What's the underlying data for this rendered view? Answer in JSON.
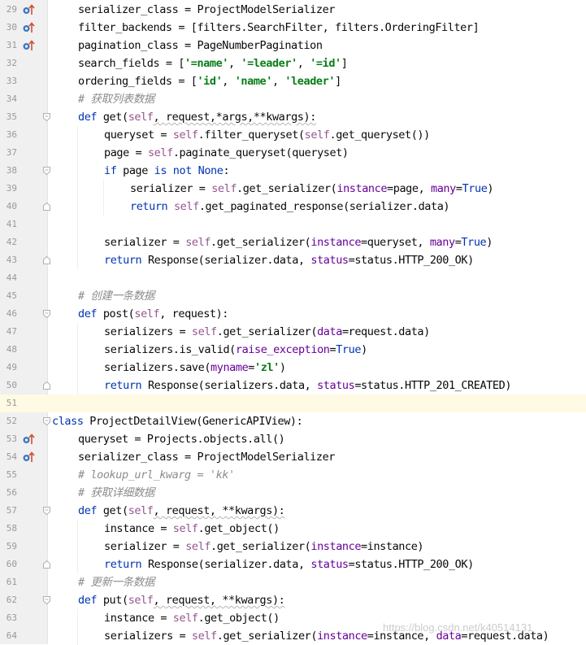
{
  "editor": {
    "language": "python",
    "current_line": 51,
    "watermark": "https://blog.csdn.net/k40514131"
  },
  "colors": {
    "keyword": "#0033b3",
    "self": "#94558d",
    "string": "#067d17",
    "comment": "#8c8c8c",
    "param": "#660099",
    "plain": "#080808",
    "gutter_bg": "#f0f0f0",
    "current_line_bg": "#fffae3",
    "override_marker": "#3d77c7",
    "override_arrow": "#d14f2d"
  },
  "lines": [
    {
      "n": "29",
      "indent": 1,
      "marker": "override",
      "fold": "",
      "tokens": [
        [
          "serializer_class = ProjectModelSerializer",
          "p"
        ]
      ]
    },
    {
      "n": "30",
      "indent": 1,
      "marker": "override",
      "fold": "",
      "tokens": [
        [
          "filter_backends = [filters.SearchFilter, filters.OrderingFilter]",
          "p"
        ]
      ]
    },
    {
      "n": "31",
      "indent": 1,
      "marker": "override",
      "fold": "",
      "tokens": [
        [
          "pagination_class = PageNumberPagination",
          "p"
        ]
      ]
    },
    {
      "n": "32",
      "indent": 1,
      "marker": "",
      "fold": "",
      "tokens": [
        [
          "search_fields = [",
          "p"
        ],
        [
          "'=name'",
          "s"
        ],
        [
          ", ",
          "p"
        ],
        [
          "'=leader'",
          "s"
        ],
        [
          ", ",
          "p"
        ],
        [
          "'=id'",
          "s"
        ],
        [
          "]",
          "p"
        ]
      ]
    },
    {
      "n": "33",
      "indent": 1,
      "marker": "",
      "fold": "",
      "tokens": [
        [
          "ordering_fields = [",
          "p"
        ],
        [
          "'id'",
          "s"
        ],
        [
          ", ",
          "p"
        ],
        [
          "'name'",
          "s"
        ],
        [
          ", ",
          "p"
        ],
        [
          "'leader'",
          "s"
        ],
        [
          "]",
          "p"
        ]
      ]
    },
    {
      "n": "34",
      "indent": 1,
      "marker": "",
      "fold": "",
      "tokens": [
        [
          "# 获取列表数据",
          "c"
        ]
      ]
    },
    {
      "n": "35",
      "indent": 1,
      "marker": "",
      "fold": "open",
      "tokens": [
        [
          "def ",
          "k"
        ],
        [
          "get(",
          "p"
        ],
        [
          "self",
          "f"
        ],
        [
          ", request,*args,**kwargs):",
          "pw"
        ]
      ]
    },
    {
      "n": "36",
      "indent": 2,
      "marker": "",
      "fold": "",
      "tokens": [
        [
          "queryset = ",
          "p"
        ],
        [
          "self",
          "f"
        ],
        [
          ".filter_queryset(",
          "p"
        ],
        [
          "self",
          "f"
        ],
        [
          ".get_queryset())",
          "p"
        ]
      ]
    },
    {
      "n": "37",
      "indent": 2,
      "marker": "",
      "fold": "",
      "tokens": [
        [
          "page = ",
          "p"
        ],
        [
          "self",
          "f"
        ],
        [
          ".paginate_queryset(queryset)",
          "p"
        ]
      ]
    },
    {
      "n": "38",
      "indent": 2,
      "marker": "",
      "fold": "open",
      "tokens": [
        [
          "if ",
          "k"
        ],
        [
          "page ",
          "p"
        ],
        [
          "is not None",
          "k"
        ],
        [
          ":",
          "p"
        ]
      ]
    },
    {
      "n": "39",
      "indent": 3,
      "marker": "",
      "fold": "",
      "tokens": [
        [
          "serializer = ",
          "p"
        ],
        [
          "self",
          "f"
        ],
        [
          ".get_serializer(",
          "p"
        ],
        [
          "instance",
          "a"
        ],
        [
          "=page, ",
          "p"
        ],
        [
          "many",
          "a"
        ],
        [
          "=",
          "p"
        ],
        [
          "True",
          "k"
        ],
        [
          ")",
          "p"
        ]
      ]
    },
    {
      "n": "40",
      "indent": 3,
      "marker": "",
      "fold": "close",
      "tokens": [
        [
          "return ",
          "k"
        ],
        [
          "self",
          "f"
        ],
        [
          ".get_paginated_response(serializer.data)",
          "p"
        ]
      ]
    },
    {
      "n": "41",
      "indent": 2,
      "marker": "",
      "fold": "",
      "tokens": []
    },
    {
      "n": "42",
      "indent": 2,
      "marker": "",
      "fold": "",
      "tokens": [
        [
          "serializer = ",
          "p"
        ],
        [
          "self",
          "f"
        ],
        [
          ".get_serializer(",
          "p"
        ],
        [
          "instance",
          "a"
        ],
        [
          "=queryset, ",
          "p"
        ],
        [
          "many",
          "a"
        ],
        [
          "=",
          "p"
        ],
        [
          "True",
          "k"
        ],
        [
          ")",
          "p"
        ]
      ]
    },
    {
      "n": "43",
      "indent": 2,
      "marker": "",
      "fold": "close",
      "tokens": [
        [
          "return ",
          "k"
        ],
        [
          "Response(serializer.data, ",
          "p"
        ],
        [
          "status",
          "a"
        ],
        [
          "=status.HTTP_200_OK)",
          "p"
        ]
      ]
    },
    {
      "n": "44",
      "indent": 1,
      "marker": "",
      "fold": "",
      "tokens": []
    },
    {
      "n": "45",
      "indent": 1,
      "marker": "",
      "fold": "",
      "tokens": [
        [
          "# 创建一条数据",
          "c"
        ]
      ]
    },
    {
      "n": "46",
      "indent": 1,
      "marker": "",
      "fold": "open",
      "tokens": [
        [
          "def ",
          "k"
        ],
        [
          "post(",
          "p"
        ],
        [
          "self",
          "f"
        ],
        [
          ", request):",
          "p"
        ]
      ]
    },
    {
      "n": "47",
      "indent": 2,
      "marker": "",
      "fold": "",
      "tokens": [
        [
          "serializers = ",
          "p"
        ],
        [
          "self",
          "f"
        ],
        [
          ".get_serializer(",
          "p"
        ],
        [
          "data",
          "a"
        ],
        [
          "=request.data)",
          "p"
        ]
      ]
    },
    {
      "n": "48",
      "indent": 2,
      "marker": "",
      "fold": "",
      "tokens": [
        [
          "serializers.is_valid(",
          "p"
        ],
        [
          "raise_exception",
          "a"
        ],
        [
          "=",
          "p"
        ],
        [
          "True",
          "k"
        ],
        [
          ")",
          "p"
        ]
      ]
    },
    {
      "n": "49",
      "indent": 2,
      "marker": "",
      "fold": "",
      "tokens": [
        [
          "serializers.save(",
          "p"
        ],
        [
          "myname",
          "a"
        ],
        [
          "=",
          "p"
        ],
        [
          "'zl'",
          "s"
        ],
        [
          ")",
          "p"
        ]
      ]
    },
    {
      "n": "50",
      "indent": 2,
      "marker": "",
      "fold": "close",
      "tokens": [
        [
          "return ",
          "k"
        ],
        [
          "Response(serializers.data, ",
          "p"
        ],
        [
          "status",
          "a"
        ],
        [
          "=status.HTTP_201_CREATED)",
          "p"
        ]
      ]
    },
    {
      "n": "51",
      "indent": 0,
      "marker": "",
      "fold": "",
      "tokens": []
    },
    {
      "n": "52",
      "indent": 0,
      "marker": "",
      "fold": "open",
      "tokens": [
        [
          "class ",
          "k"
        ],
        [
          "ProjectDetailView(GenericAPIView):",
          "p"
        ]
      ]
    },
    {
      "n": "53",
      "indent": 1,
      "marker": "override",
      "fold": "",
      "tokens": [
        [
          "queryset = Projects.objects.all()",
          "p"
        ]
      ]
    },
    {
      "n": "54",
      "indent": 1,
      "marker": "override",
      "fold": "",
      "tokens": [
        [
          "serializer_class = ProjectModelSerializer",
          "p"
        ]
      ]
    },
    {
      "n": "55",
      "indent": 1,
      "marker": "",
      "fold": "",
      "tokens": [
        [
          "# lookup_url_kwarg = 'kk'",
          "c"
        ]
      ]
    },
    {
      "n": "56",
      "indent": 1,
      "marker": "",
      "fold": "",
      "tokens": [
        [
          "# 获取详细数据",
          "c"
        ]
      ]
    },
    {
      "n": "57",
      "indent": 1,
      "marker": "",
      "fold": "open",
      "tokens": [
        [
          "def ",
          "k"
        ],
        [
          "get(",
          "p"
        ],
        [
          "self",
          "f"
        ],
        [
          ", request, **kwargs):",
          "pw"
        ]
      ]
    },
    {
      "n": "58",
      "indent": 2,
      "marker": "",
      "fold": "",
      "tokens": [
        [
          "instance = ",
          "p"
        ],
        [
          "self",
          "f"
        ],
        [
          ".get_object()",
          "p"
        ]
      ]
    },
    {
      "n": "59",
      "indent": 2,
      "marker": "",
      "fold": "",
      "tokens": [
        [
          "serializer = ",
          "p"
        ],
        [
          "self",
          "f"
        ],
        [
          ".get_serializer(",
          "p"
        ],
        [
          "instance",
          "a"
        ],
        [
          "=instance)",
          "p"
        ]
      ]
    },
    {
      "n": "60",
      "indent": 2,
      "marker": "",
      "fold": "close",
      "tokens": [
        [
          "return ",
          "k"
        ],
        [
          "Response(serializer.data, ",
          "p"
        ],
        [
          "status",
          "a"
        ],
        [
          "=status.HTTP_200_OK)",
          "p"
        ]
      ]
    },
    {
      "n": "61",
      "indent": 1,
      "marker": "",
      "fold": "",
      "tokens": [
        [
          "# 更新一条数据",
          "c"
        ]
      ]
    },
    {
      "n": "62",
      "indent": 1,
      "marker": "",
      "fold": "open",
      "tokens": [
        [
          "def ",
          "k"
        ],
        [
          "put(",
          "p"
        ],
        [
          "self",
          "f"
        ],
        [
          ", request, **kwargs):",
          "pw"
        ]
      ]
    },
    {
      "n": "63",
      "indent": 2,
      "marker": "",
      "fold": "",
      "tokens": [
        [
          "instance = ",
          "p"
        ],
        [
          "self",
          "f"
        ],
        [
          ".get_object()",
          "p"
        ]
      ]
    },
    {
      "n": "64",
      "indent": 2,
      "marker": "",
      "fold": "",
      "tokens": [
        [
          "serializers = ",
          "p"
        ],
        [
          "self",
          "f"
        ],
        [
          ".get_serializer(",
          "p"
        ],
        [
          "instance",
          "a"
        ],
        [
          "=instance, ",
          "p"
        ],
        [
          "data",
          "a"
        ],
        [
          "=request.data)",
          "p"
        ]
      ]
    }
  ]
}
